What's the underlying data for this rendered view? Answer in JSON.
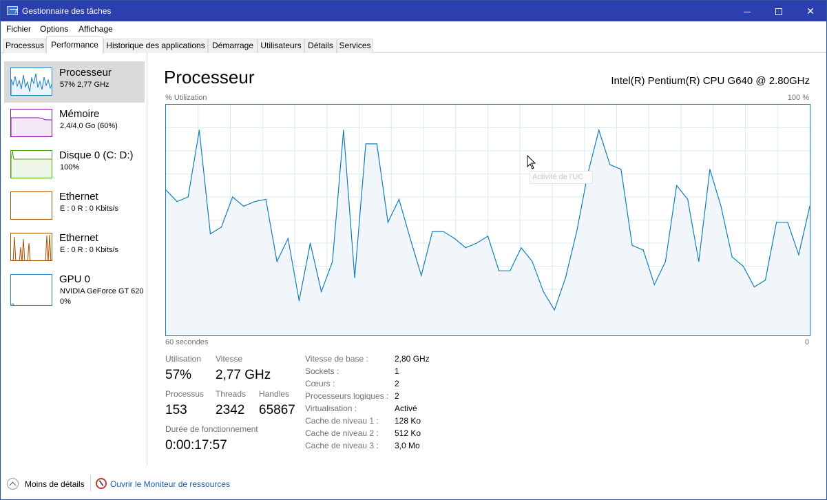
{
  "window": {
    "title": "Gestionnaire des tâches",
    "controls": {
      "minimize": "",
      "maximize": "",
      "close": "✕"
    }
  },
  "menu": [
    "Fichier",
    "Options",
    "Affichage"
  ],
  "tabs": [
    "Processus",
    "Performance",
    "Historique des applications",
    "Démarrage",
    "Utilisateurs",
    "Détails",
    "Services"
  ],
  "active_tab": "Performance",
  "sidebar": [
    {
      "title": "Processeur",
      "sub": "57%  2,77 GHz",
      "color": "#117dbb",
      "selected": true
    },
    {
      "title": "Mémoire",
      "sub": "2,4/4,0 Go (60%)",
      "color": "#8b12ae"
    },
    {
      "title": "Disque 0 (C: D:)",
      "sub": "100%",
      "color": "#4da60c"
    },
    {
      "title": "Ethernet",
      "sub": "E : 0  R : 0 Kbits/s",
      "color": "#a74f01"
    },
    {
      "title": "Ethernet",
      "sub": "E : 0  R : 0 Kbits/s",
      "color": "#a74f01"
    },
    {
      "title": "GPU 0",
      "sub": "NVIDIA GeForce GT 620",
      "sub2": "0%",
      "color": "#117dbb"
    }
  ],
  "main": {
    "title": "Processeur",
    "cpu_name": "Intel(R) Pentium(R) CPU G640 @ 2.80GHz",
    "graph_label_left": "% Utilization",
    "graph_label_right": "100 %",
    "graph_time_left": "60 secondes",
    "graph_time_right": "0",
    "tooltip": "Activité de l'UC",
    "line_color": "#117dbb",
    "fill_color": "#f1f6fa",
    "grid_color": "#d9eaf4"
  },
  "chart_data": {
    "type": "area",
    "title": "% Utilization",
    "xlabel": "60 secondes",
    "ylim": [
      0,
      100
    ],
    "values": [
      63,
      58,
      60,
      89,
      44,
      47,
      60,
      56,
      58,
      59,
      32,
      42,
      15,
      40,
      19,
      32,
      89,
      25,
      83,
      83,
      49,
      59,
      42,
      26,
      45,
      45,
      42,
      38,
      40,
      43,
      28,
      28,
      38,
      32,
      19,
      11,
      25,
      45,
      70,
      89,
      74,
      72,
      39,
      37,
      22,
      32,
      65,
      59,
      32,
      72,
      56,
      34,
      30,
      21,
      24,
      49,
      49,
      35,
      56
    ],
    "series_name": ""
  },
  "stats": {
    "utilisation_label": "Utilisation",
    "utilisation": "57%",
    "vitesse_label": "Vitesse",
    "vitesse": "2,77 GHz",
    "processus_label": "Processus",
    "processus": "153",
    "threads_label": "Threads",
    "threads": "2342",
    "handles_label": "Handles",
    "handles": "65867",
    "uptime_label": "Durée de fonctionnement",
    "uptime": "0:00:17:57"
  },
  "specs": [
    {
      "label": "Vitesse de base :",
      "value": "2,80 GHz"
    },
    {
      "label": "Sockets :",
      "value": "1"
    },
    {
      "label": "Cœurs :",
      "value": "2"
    },
    {
      "label": "Processeurs logiques :",
      "value": "2"
    },
    {
      "label": "Virtualisation :",
      "value": "Activé"
    },
    {
      "label": "Cache de niveau 1 :",
      "value": "128 Ko"
    },
    {
      "label": "Cache de niveau 2 :",
      "value": "512 Ko"
    },
    {
      "label": "Cache de niveau 3 :",
      "value": "3,0 Mo"
    }
  ],
  "footer": {
    "less_details": "Moins de détails",
    "open_monitor": "Ouvrir le Moniteur de ressources"
  }
}
